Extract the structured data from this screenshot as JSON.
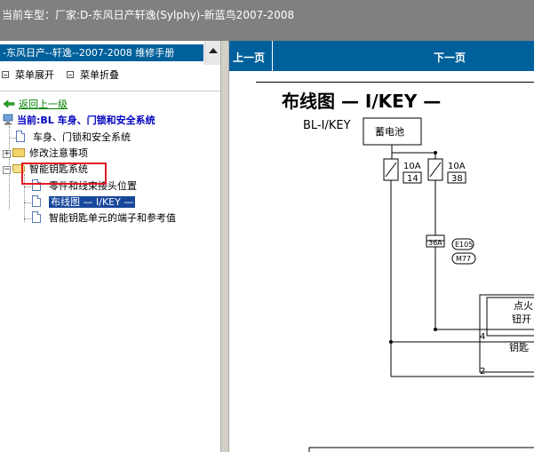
{
  "window": {
    "title": "当前车型：厂家:D-东风日产轩逸(Sylphy)-新蓝鸟2007-2008"
  },
  "sidebar": {
    "header": "-东风日产--轩逸--2007-2008 维修手册",
    "expand_label": "菜单展开",
    "collapse_label": "菜单折叠",
    "tree": {
      "back_label": "返回上一级",
      "current_label": "当前:BL 车身、门锁和安全系统",
      "items": [
        {
          "label": "车身、门锁和安全系统"
        },
        {
          "label": "修改注意事项"
        },
        {
          "label": "智能钥匙系统"
        },
        {
          "label": "零件和线束接头位置"
        },
        {
          "label": "布线图 — I/KEY —"
        },
        {
          "label": "智能钥匙单元的端子和参考值"
        }
      ]
    }
  },
  "content": {
    "nav": {
      "prev_label": "上一页",
      "next_label": "下一页"
    },
    "title": "布线图 — I/KEY —",
    "subtitle": "BL-I/KEY",
    "diagram": {
      "battery": "蓄电池",
      "fuse1_amp": "10A",
      "fuse1_no": "14",
      "fuse2_amp": "10A",
      "fuse2_no": "38",
      "connector": "36A",
      "conn1": "E105",
      "conn2": "M77",
      "pin4": "4",
      "pin2": "2",
      "box1_l1": "点火",
      "box1_l2": "钮开",
      "box2_l1": "钥匙"
    }
  }
}
